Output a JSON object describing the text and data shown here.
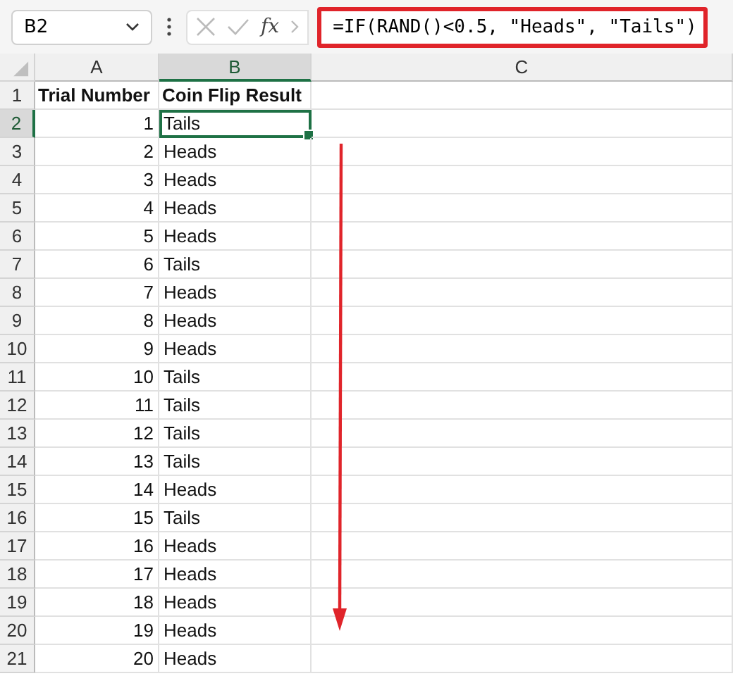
{
  "formula_bar": {
    "name_box": "B2",
    "function_label": "fx",
    "formula": "=IF(RAND()<0.5, \"Heads\", \"Tails\")"
  },
  "columns": [
    {
      "label": "A",
      "selected": false
    },
    {
      "label": "B",
      "selected": true
    },
    {
      "label": "C",
      "selected": false
    }
  ],
  "rows": [
    {
      "number": "1",
      "bold": true,
      "selected": false,
      "cells": [
        "Trial Number",
        "Coin Flip Result"
      ]
    },
    {
      "number": "2",
      "bold": false,
      "selected": true,
      "cells": [
        "1",
        "Tails"
      ]
    },
    {
      "number": "3",
      "bold": false,
      "selected": false,
      "cells": [
        "2",
        "Heads"
      ]
    },
    {
      "number": "4",
      "bold": false,
      "selected": false,
      "cells": [
        "3",
        "Heads"
      ]
    },
    {
      "number": "5",
      "bold": false,
      "selected": false,
      "cells": [
        "4",
        "Heads"
      ]
    },
    {
      "number": "6",
      "bold": false,
      "selected": false,
      "cells": [
        "5",
        "Heads"
      ]
    },
    {
      "number": "7",
      "bold": false,
      "selected": false,
      "cells": [
        "6",
        "Tails"
      ]
    },
    {
      "number": "8",
      "bold": false,
      "selected": false,
      "cells": [
        "7",
        "Heads"
      ]
    },
    {
      "number": "9",
      "bold": false,
      "selected": false,
      "cells": [
        "8",
        "Heads"
      ]
    },
    {
      "number": "10",
      "bold": false,
      "selected": false,
      "cells": [
        "9",
        "Heads"
      ]
    },
    {
      "number": "11",
      "bold": false,
      "selected": false,
      "cells": [
        "10",
        "Tails"
      ]
    },
    {
      "number": "12",
      "bold": false,
      "selected": false,
      "cells": [
        "11",
        "Tails"
      ]
    },
    {
      "number": "13",
      "bold": false,
      "selected": false,
      "cells": [
        "12",
        "Tails"
      ]
    },
    {
      "number": "14",
      "bold": false,
      "selected": false,
      "cells": [
        "13",
        "Tails"
      ]
    },
    {
      "number": "15",
      "bold": false,
      "selected": false,
      "cells": [
        "14",
        "Heads"
      ]
    },
    {
      "number": "16",
      "bold": false,
      "selected": false,
      "cells": [
        "15",
        "Tails"
      ]
    },
    {
      "number": "17",
      "bold": false,
      "selected": false,
      "cells": [
        "16",
        "Heads"
      ]
    },
    {
      "number": "18",
      "bold": false,
      "selected": false,
      "cells": [
        "17",
        "Heads"
      ]
    },
    {
      "number": "19",
      "bold": false,
      "selected": false,
      "cells": [
        "18",
        "Heads"
      ]
    },
    {
      "number": "20",
      "bold": false,
      "selected": false,
      "cells": [
        "19",
        "Heads"
      ]
    },
    {
      "number": "21",
      "bold": false,
      "selected": false,
      "cells": [
        "20",
        "Heads"
      ]
    }
  ]
}
